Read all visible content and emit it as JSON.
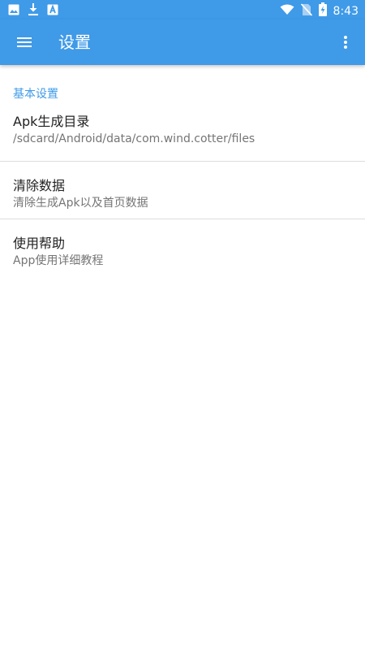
{
  "status_bar": {
    "time": "8:43",
    "left_icons": [
      "image-icon",
      "download-icon",
      "android-icon"
    ],
    "right_icons": [
      "wifi-icon",
      "no-sim-icon",
      "battery-charging-icon"
    ]
  },
  "app_bar": {
    "title": "设置",
    "menu_icon": "hamburger-menu-icon",
    "overflow_icon": "more-vert-icon",
    "color": "#3f9ae8"
  },
  "settings": {
    "category_label": "基本设置",
    "items": [
      {
        "title": "Apk生成目录",
        "summary": "/sdcard/Android/data/com.wind.cotter/files"
      },
      {
        "title": "清除数据",
        "summary": "清除生成Apk以及首页数据"
      },
      {
        "title": "使用帮助",
        "summary": "App使用详细教程"
      }
    ]
  }
}
